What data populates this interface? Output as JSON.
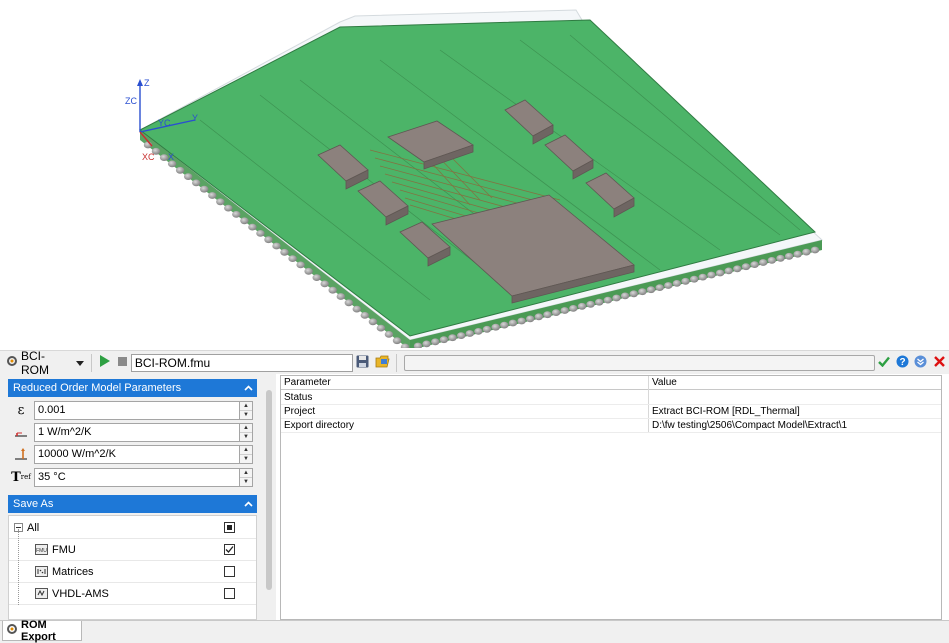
{
  "viewport": {
    "axes": {
      "z": "Z",
      "zc": "ZC",
      "yc": "YC",
      "y": "Y",
      "xc": "XC",
      "x": "X"
    }
  },
  "toolbar": {
    "rom_label": "BCI-ROM",
    "fmu_value": "BCI-ROM.fmu",
    "icons": [
      "bci-rom-icon",
      "dropdown-arrow-icon",
      "run-icon",
      "stop-icon",
      "save-icon",
      "open-folder-icon",
      "accept-icon",
      "help-icon",
      "expand-icon",
      "close-icon"
    ],
    "colors": {
      "run": "#2ea043",
      "accept": "#2ea043",
      "help": "#1e78d7",
      "close": "#d11"
    }
  },
  "rom_params": {
    "header": "Reduced Order Model Parameters",
    "params": [
      {
        "symbol": "ε",
        "value": "0.001"
      },
      {
        "symbol": "h-min",
        "value": "1 W/m^2/K"
      },
      {
        "symbol": "h-max",
        "value": "10000 W/m^2/K"
      },
      {
        "symbol": "T",
        "sub": "ref",
        "value": "35 °C"
      }
    ]
  },
  "save_as": {
    "header": "Save As",
    "root": {
      "label": "All",
      "state": "partial"
    },
    "items": [
      {
        "label": "FMU",
        "checked": true,
        "icon": "fmu-icon"
      },
      {
        "label": "Matrices",
        "checked": false,
        "icon": "matrices-icon"
      },
      {
        "label": "VHDL-AMS",
        "checked": false,
        "icon": "vhdl-icon"
      }
    ]
  },
  "table": {
    "columns": [
      "Parameter",
      "Value"
    ],
    "rows": [
      {
        "param": "Status",
        "value": ""
      },
      {
        "param": "Project",
        "value": "Extract BCI-ROM [RDL_Thermal]"
      },
      {
        "param": "Export directory",
        "value": "D:\\fw testing\\2506\\Compact Model\\Extract\\1"
      }
    ]
  },
  "bottom_tab": {
    "label": "ROM Export"
  }
}
